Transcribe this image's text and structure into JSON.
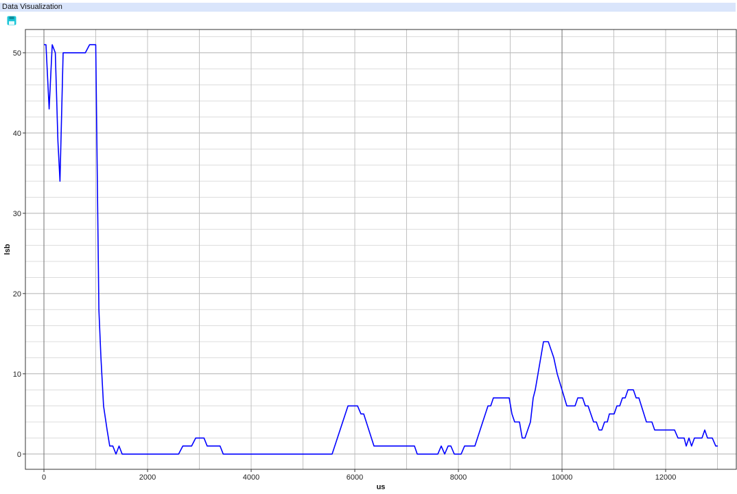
{
  "window": {
    "title": "Data Visualization"
  },
  "toolbar": {
    "save_icon": "save-icon",
    "save_color": "#1cc6d8"
  },
  "chart_data": {
    "type": "line",
    "title": "",
    "xlabel": "us",
    "ylabel": "lsb",
    "xlim": [
      -358,
      13364
    ],
    "ylim": [
      -1.9,
      52.9
    ],
    "xticks": [
      0,
      2000,
      4000,
      6000,
      8000,
      10000,
      12000
    ],
    "yticks": [
      0,
      10,
      20,
      30,
      40,
      50
    ],
    "grid": true,
    "series": [
      {
        "name": "lsb",
        "color": "#0000ff",
        "points": [
          [
            0,
            51
          ],
          [
            40,
            51
          ],
          [
            100,
            43
          ],
          [
            160,
            51
          ],
          [
            220,
            50
          ],
          [
            270,
            39
          ],
          [
            310,
            34
          ],
          [
            370,
            50
          ],
          [
            800,
            50
          ],
          [
            880,
            51
          ],
          [
            1000,
            51
          ],
          [
            1060,
            18
          ],
          [
            1100,
            12
          ],
          [
            1150,
            6
          ],
          [
            1220,
            3
          ],
          [
            1270,
            1
          ],
          [
            1330,
            1
          ],
          [
            1390,
            0
          ],
          [
            1450,
            1
          ],
          [
            1510,
            0
          ],
          [
            2600,
            0
          ],
          [
            2680,
            1
          ],
          [
            2850,
            1
          ],
          [
            2930,
            2
          ],
          [
            3090,
            2
          ],
          [
            3150,
            1
          ],
          [
            3400,
            1
          ],
          [
            3460,
            0
          ],
          [
            5563,
            0
          ],
          [
            5868,
            6
          ],
          [
            6053,
            6
          ],
          [
            6119,
            5
          ],
          [
            6172,
            5
          ],
          [
            6371,
            1
          ],
          [
            7152,
            1
          ],
          [
            7205,
            0
          ],
          [
            7603,
            0
          ],
          [
            7669,
            1
          ],
          [
            7735,
            0
          ],
          [
            7801,
            1
          ],
          [
            7854,
            1
          ],
          [
            7920,
            0
          ],
          [
            8053,
            0
          ],
          [
            8119,
            1
          ],
          [
            8318,
            1
          ],
          [
            8570,
            6
          ],
          [
            8623,
            6
          ],
          [
            8675,
            7
          ],
          [
            8980,
            7
          ],
          [
            9033,
            5
          ],
          [
            9086,
            4
          ],
          [
            9179,
            4
          ],
          [
            9232,
            2
          ],
          [
            9285,
            2
          ],
          [
            9391,
            4
          ],
          [
            9444,
            7
          ],
          [
            9483,
            8
          ],
          [
            9642,
            14
          ],
          [
            9735,
            14
          ],
          [
            9841,
            12
          ],
          [
            9907,
            10
          ],
          [
            10093,
            6
          ],
          [
            10252,
            6
          ],
          [
            10305,
            7
          ],
          [
            10397,
            7
          ],
          [
            10450,
            6
          ],
          [
            10503,
            6
          ],
          [
            10609,
            4
          ],
          [
            10662,
            4
          ],
          [
            10715,
            3
          ],
          [
            10768,
            3
          ],
          [
            10821,
            4
          ],
          [
            10874,
            4
          ],
          [
            10914,
            5
          ],
          [
            11007,
            5
          ],
          [
            11060,
            6
          ],
          [
            11113,
            6
          ],
          [
            11166,
            7
          ],
          [
            11219,
            7
          ],
          [
            11272,
            8
          ],
          [
            11377,
            8
          ],
          [
            11430,
            7
          ],
          [
            11483,
            7
          ],
          [
            11629,
            4
          ],
          [
            11735,
            4
          ],
          [
            11788,
            3
          ],
          [
            12172,
            3
          ],
          [
            12238,
            2
          ],
          [
            12357,
            2
          ],
          [
            12397,
            1
          ],
          [
            12450,
            2
          ],
          [
            12500,
            1
          ],
          [
            12556,
            2
          ],
          [
            12702,
            2
          ],
          [
            12755,
            3
          ],
          [
            12808,
            2
          ],
          [
            12900,
            2
          ],
          [
            12966,
            1
          ],
          [
            13007,
            1
          ]
        ]
      }
    ]
  }
}
